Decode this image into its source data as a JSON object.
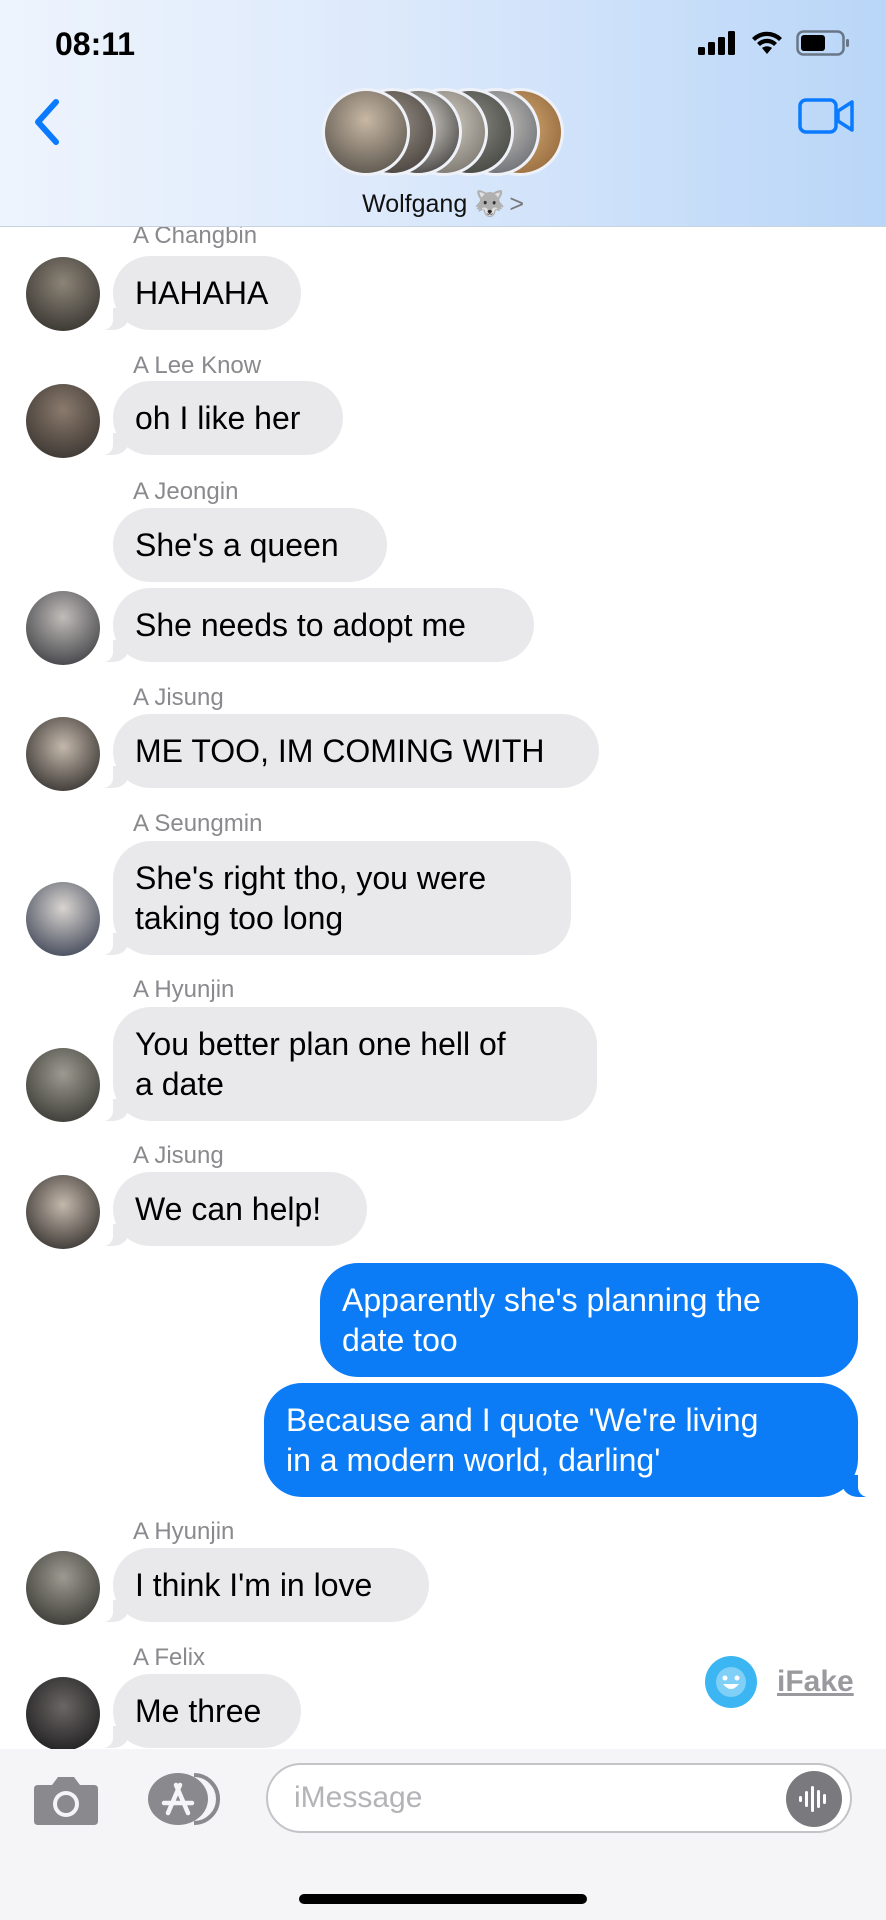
{
  "status_bar": {
    "time": "08:11"
  },
  "header": {
    "group_name": "Wolfgang 🐺",
    "chevron": ">"
  },
  "messages": [
    {
      "sender": "A Changbin",
      "text": "HAHAHA",
      "direction": "incoming",
      "avatar_color": "#3b3a36"
    },
    {
      "sender": "A Lee Know",
      "text": "oh I like her",
      "direction": "incoming",
      "avatar_color": "#4a4442"
    },
    {
      "sender": "A Jeongin",
      "text": "She's a queen",
      "direction": "incoming"
    },
    {
      "text": "She needs to adopt me",
      "direction": "incoming",
      "avatar_color": "#5b6068"
    },
    {
      "sender": "A Jisung",
      "text": "ME TOO, IM COMING WITH",
      "direction": "incoming",
      "avatar_color": "#2c2a26"
    },
    {
      "sender": "A Seungmin",
      "text": "She's right tho, you were taking too long",
      "line1": "She's right tho, you were",
      "line2": "taking too long",
      "direction": "incoming",
      "avatar_color": "#3b4456"
    },
    {
      "sender": "A Hyunjin",
      "text": "You better plan one hell of a date",
      "line1": "You better plan one hell of",
      "line2": "a date",
      "direction": "incoming",
      "avatar_color": "#5a5a50"
    },
    {
      "sender": "A Jisung",
      "text": "We can help!",
      "direction": "incoming",
      "avatar_color": "#2c2a26"
    },
    {
      "text": "Apparently she's planning the date too",
      "line1": "Apparently she's planning the",
      "line2": "date too",
      "direction": "outgoing"
    },
    {
      "text": "Because and I quote 'We're living in a modern world, darling'",
      "line1": "Because and I quote 'We're living",
      "line2": "in a modern world, darling'",
      "direction": "outgoing"
    },
    {
      "sender": "A Hyunjin",
      "text": "I think I'm in love",
      "direction": "incoming",
      "avatar_color": "#5a5a50"
    },
    {
      "sender": "A Felix",
      "text": "Me three",
      "direction": "incoming",
      "avatar_color": "#1e1e20"
    }
  ],
  "watermark": {
    "label": "iFake"
  },
  "composer": {
    "placeholder": "iMessage"
  },
  "colors": {
    "incoming_bubble": "#e9e9eb",
    "outgoing_bubble": "#0b7cf5",
    "accent": "#0a7aff"
  }
}
